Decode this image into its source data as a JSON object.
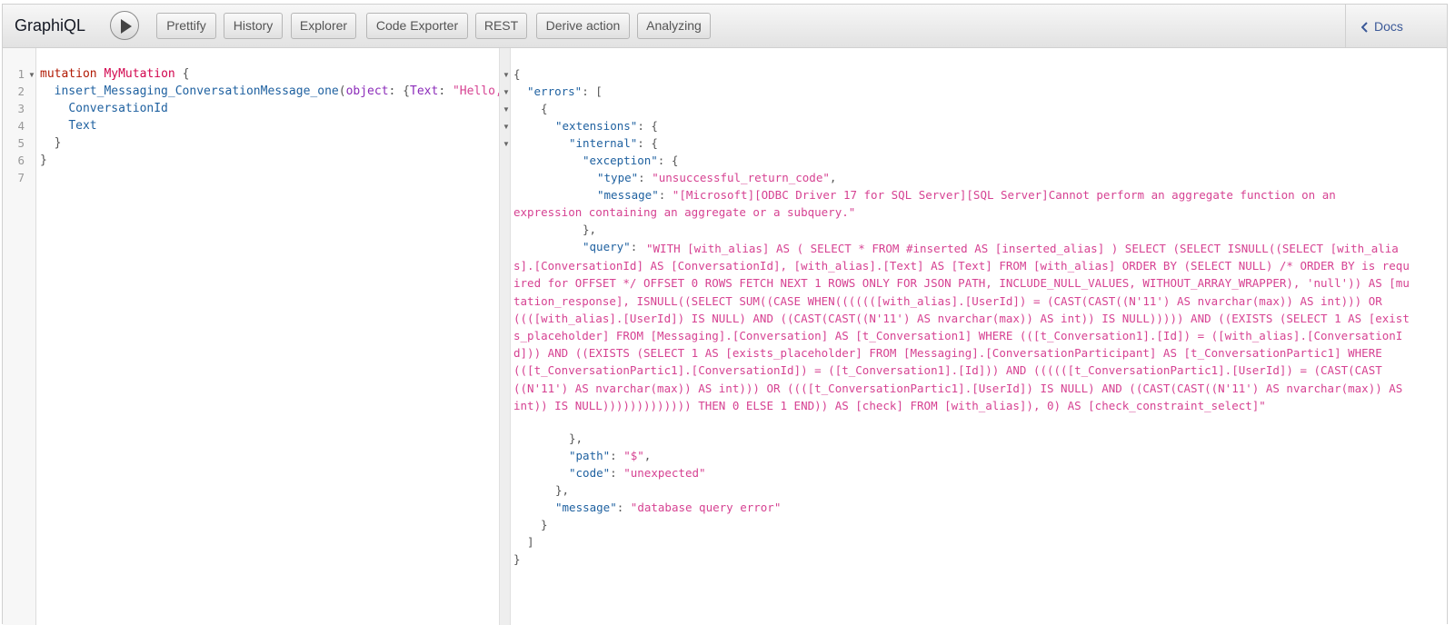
{
  "app": {
    "title": "GraphiQL"
  },
  "toolbar": {
    "execute_icon": "play-icon",
    "buttons": [
      "Prettify",
      "History",
      "Explorer",
      "Code Exporter",
      "REST",
      "Derive action",
      "Analyzing"
    ],
    "docs_label": "Docs",
    "docs_icon": "chevron-left-icon"
  },
  "editor": {
    "line_numbers": [
      "1",
      "2",
      "3",
      "4",
      "5",
      "6",
      "7"
    ],
    "line1": {
      "kw": "mutation",
      "name": "MyMutation",
      "brace": "{"
    },
    "line2": {
      "field": "insert_Messaging_ConversationMessage_one",
      "paren": "(",
      "arg": "object",
      "colon": ": {",
      "inner_key": "Text",
      "inner_colon": ": ",
      "string": "\"Hello,"
    },
    "line3": "ConversationId",
    "line4": "Text",
    "line5": "}",
    "line6": "}"
  },
  "result": {
    "open_brace": "{",
    "errors_key": "\"errors\"",
    "bracket_open": ": [",
    "obj_open": "{",
    "extensions_key": "\"extensions\"",
    "internal_key": "\"internal\"",
    "exception_key": "\"exception\"",
    "type_key": "\"type\"",
    "type_value": "\"unsuccessful_return_code\"",
    "message_key": "\"message\"",
    "message_line1": "\"[Microsoft][ODBC Driver 17 for SQL Server][SQL Server]Cannot perform an aggregate function on an",
    "message_line2": "expression containing an aggregate or a subquery.\"",
    "close_exception": "},",
    "query_key": "\"query\"",
    "query_value": "\"WITH [with_alias] AS ( SELECT * FROM #inserted AS [inserted_alias] ) SELECT (SELECT ISNULL((SELECT [with_alias].[ConversationId] AS [ConversationId], [with_alias].[Text] AS [Text] FROM [with_alias] ORDER BY (SELECT NULL) /* ORDER BY is required for OFFSET */ OFFSET 0 ROWS FETCH NEXT 1 ROWS ONLY FOR JSON PATH, INCLUDE_NULL_VALUES, WITHOUT_ARRAY_WRAPPER), 'null')) AS [mutation_response], ISNULL((SELECT SUM((CASE WHEN(((((([with_alias].[UserId]) = (CAST(CAST((N'11') AS nvarchar(max)) AS int))) OR ((([with_alias].[UserId]) IS NULL) AND ((CAST(CAST((N'11') AS nvarchar(max)) AS int)) IS NULL))))) AND ((EXISTS (SELECT 1 AS [exists_placeholder] FROM [Messaging].[Conversation] AS [t_Conversation1] WHERE (([t_Conversation1].[Id]) = ([with_alias].[ConversationId])) AND ((EXISTS (SELECT 1 AS [exists_placeholder] FROM [Messaging].[ConversationParticipant] AS [t_ConversationPartic1] WHERE (([t_ConversationPartic1].[ConversationId]) = ([t_Conversation1].[Id])) AND ((((([t_ConversationPartic1].[UserId]) = (CAST(CAST((N'11') AS nvarchar(max)) AS int))) OR ((([t_ConversationPartic1].[UserId]) IS NULL) AND ((CAST(CAST((N'11') AS nvarchar(max)) AS int)) IS NULL))))))))))))) THEN 0 ELSE 1 END)) AS [check] FROM [with_alias]), 0) AS [check_constraint_select]\"",
    "close_internal": "},",
    "path_key": "\"path\"",
    "path_value": "\"$\"",
    "code_key": "\"code\"",
    "code_value": "\"unexpected\"",
    "close_extensions": "},",
    "message2_key": "\"message\"",
    "message2_value": "\"database query error\"",
    "close_obj": "}",
    "close_bracket": "]",
    "close_brace": "}"
  }
}
